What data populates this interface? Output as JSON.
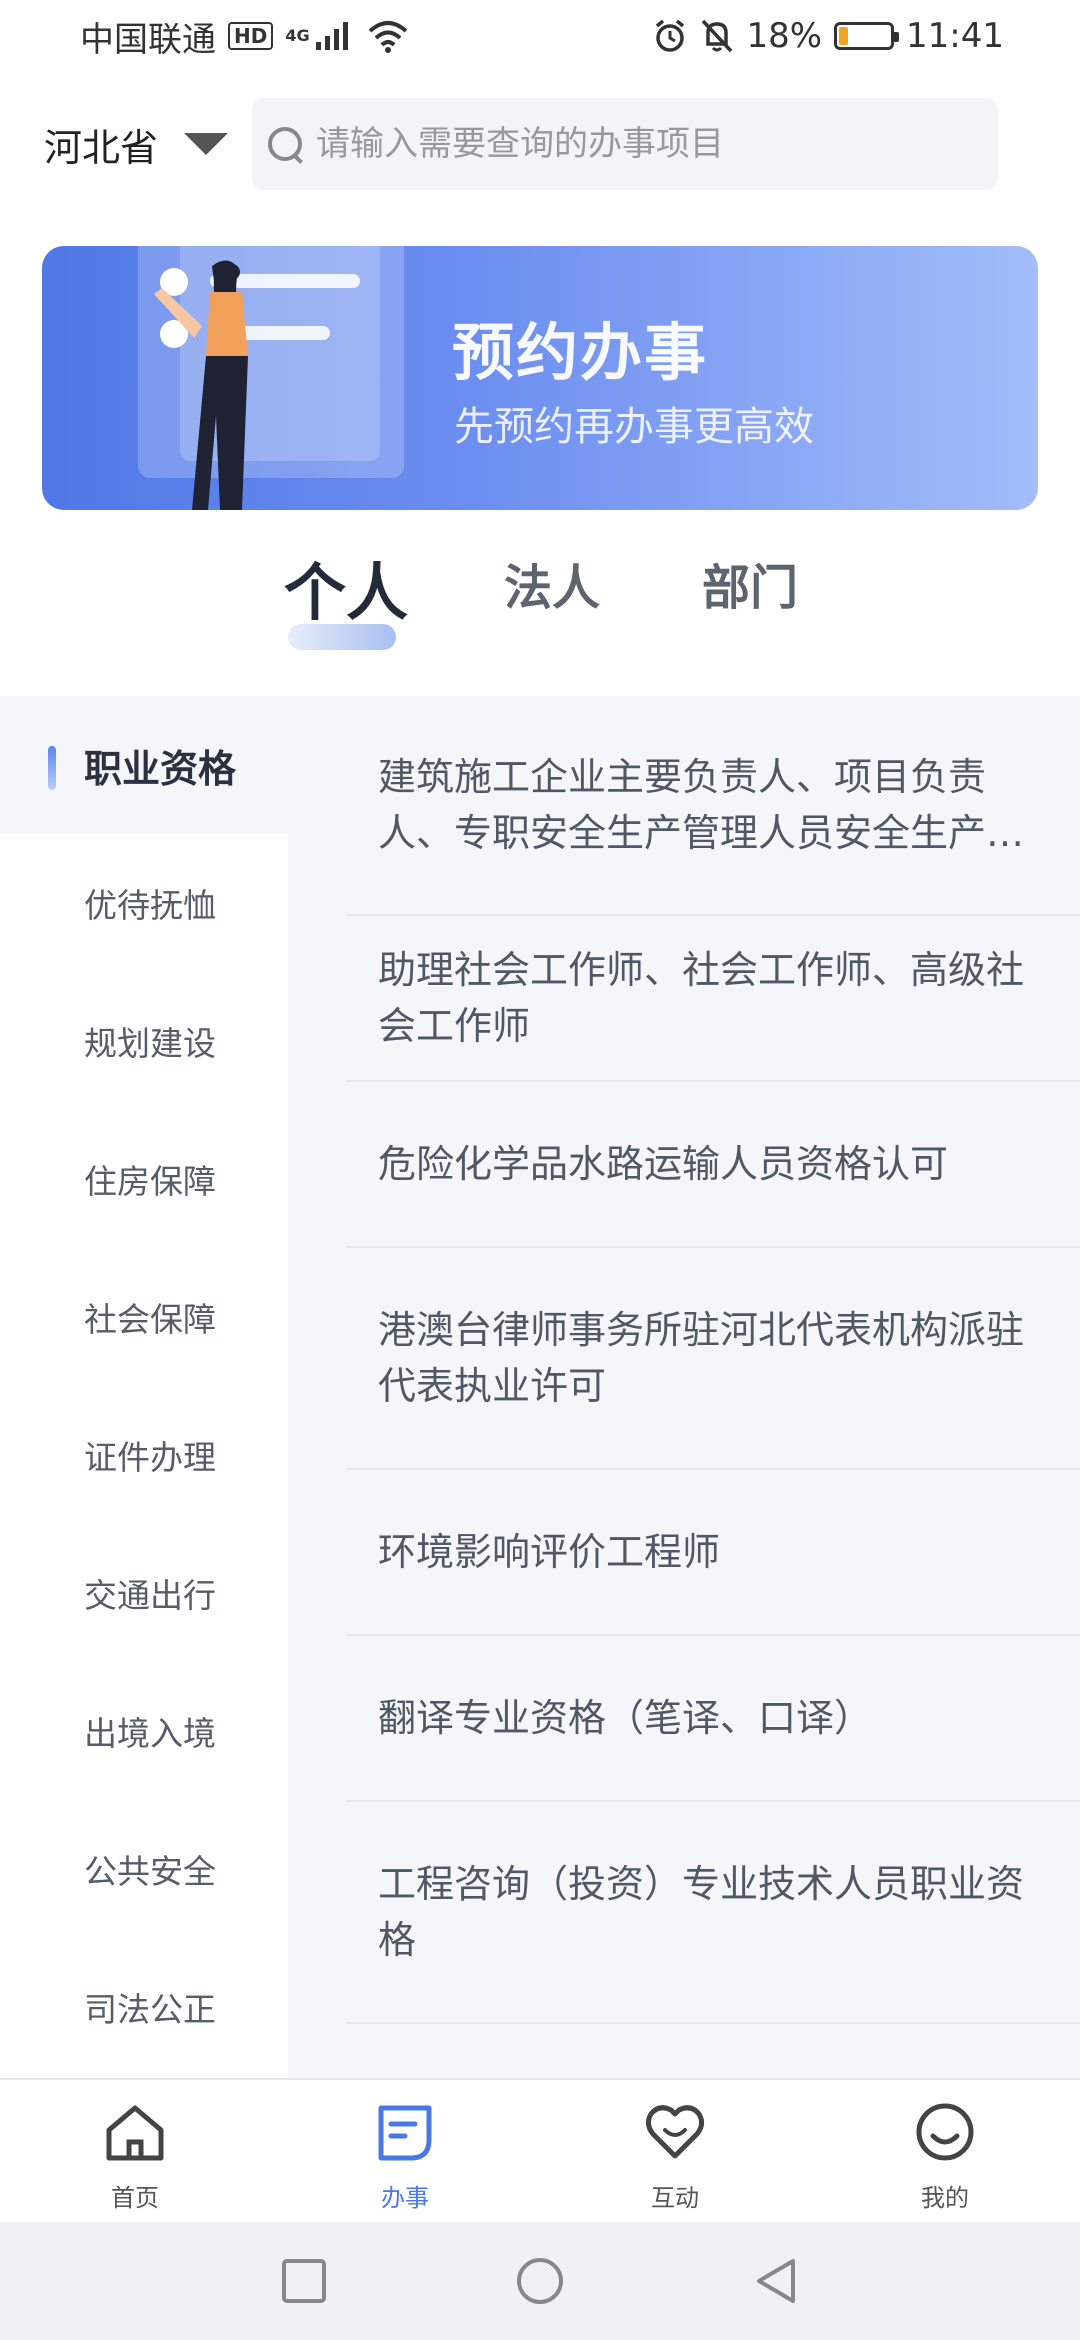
{
  "status_bar": {
    "carrier": "中国联通",
    "hd": "HD",
    "network": "4G",
    "battery": "18%",
    "time": "11:41"
  },
  "header": {
    "province": "河北省",
    "search_placeholder": "请输入需要查询的办事项目"
  },
  "banner": {
    "title": "预约办事",
    "subtitle": "先预约再办事更高效"
  },
  "tabs": [
    "个人",
    "法人",
    "部门"
  ],
  "sidebar": {
    "items": [
      "职业资格",
      "优待抚恤",
      "规划建设",
      "住房保障",
      "社会保障",
      "证件办理",
      "交通出行",
      "出境入境",
      "公共安全",
      "司法公正"
    ]
  },
  "list": {
    "items": [
      "建筑施工企业主要负责人、项目负责人、专职安全生产管理人员安全生产考核",
      "助理社会工作师、社会工作师、高级社会工作师",
      "危险化学品水路运输人员资格认可",
      "港澳台律师事务所驻河北代表机构派驻代表执业许可",
      "环境影响评价工程师",
      "翻译专业资格（笔译、口译）",
      "工程咨询（投资）专业技术人员职业资格"
    ]
  },
  "bottom_nav": [
    "首页",
    "办事",
    "互动",
    "我的"
  ],
  "colors": {
    "accent": "#4a78e8",
    "banner_start": "#4f78e6",
    "banner_end": "#a3bdf9",
    "content_bg": "#f4f6f9"
  },
  "battery_level": 0.18
}
